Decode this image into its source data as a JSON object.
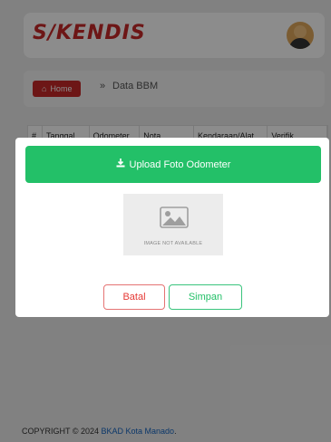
{
  "app": {
    "logo": "S/KENDIS"
  },
  "breadcrumb": {
    "home_label": "Home",
    "separator": "»",
    "current": "Data BBM"
  },
  "table": {
    "headers": [
      "#",
      "Tanggal",
      "Odometer",
      "Nota",
      "Kendaraan/Alat",
      "Verifik"
    ]
  },
  "modal": {
    "upload_label": "Upload Foto Odometer",
    "placeholder_text": "IMAGE NOT AVAILABLE",
    "cancel_label": "Batal",
    "save_label": "Simpan"
  },
  "footer": {
    "copyright": "COPYRIGHT © 2024 ",
    "org": "BKAD Kota Manado",
    "suffix": "."
  },
  "colors": {
    "brand": "#c62828",
    "success": "#23c068",
    "danger": "#e53935",
    "link": "#1565c0"
  }
}
